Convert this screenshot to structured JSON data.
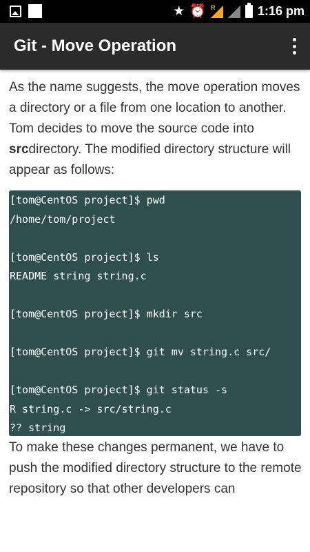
{
  "status_bar": {
    "time": "1:16 pm",
    "icons": [
      "image-icon",
      "white-square-icon",
      "star-icon",
      "alarm-icon",
      "signal-r-icon",
      "signal-icon",
      "battery-icon"
    ],
    "star_glyph": "★",
    "alarm_glyph": "⏰",
    "r_label": "R"
  },
  "app_bar": {
    "title": "Git - Move Operation",
    "menu_icon": "overflow-menu-icon"
  },
  "content": {
    "para1_a": "As the name suggests, the move operation moves a directory or a file from one location to another. Tom decides to move the source code into ",
    "para1_bold": "src",
    "para1_b": "directory. The modified directory structure will appear as follows:",
    "code_lines": [
      "[tom@CentOS project]$ pwd",
      "/home/tom/project",
      "",
      "[tom@CentOS project]$ ls",
      "README string string.c",
      "",
      "[tom@CentOS project]$ mkdir src",
      "",
      "[tom@CentOS project]$ git mv string.c src/",
      "",
      "[tom@CentOS project]$ git status -s",
      "R string.c -> src/string.c",
      "?? string"
    ],
    "para2": "To make these changes permanent, we have to push the modified directory structure to the remote repository so that other developers can"
  },
  "colors": {
    "status_bar_bg": "#000000",
    "app_bar_bg": "#2b2b2b",
    "code_bg": "#2f4f4f",
    "text": "#333333",
    "signal_accent": "#f5a623"
  }
}
